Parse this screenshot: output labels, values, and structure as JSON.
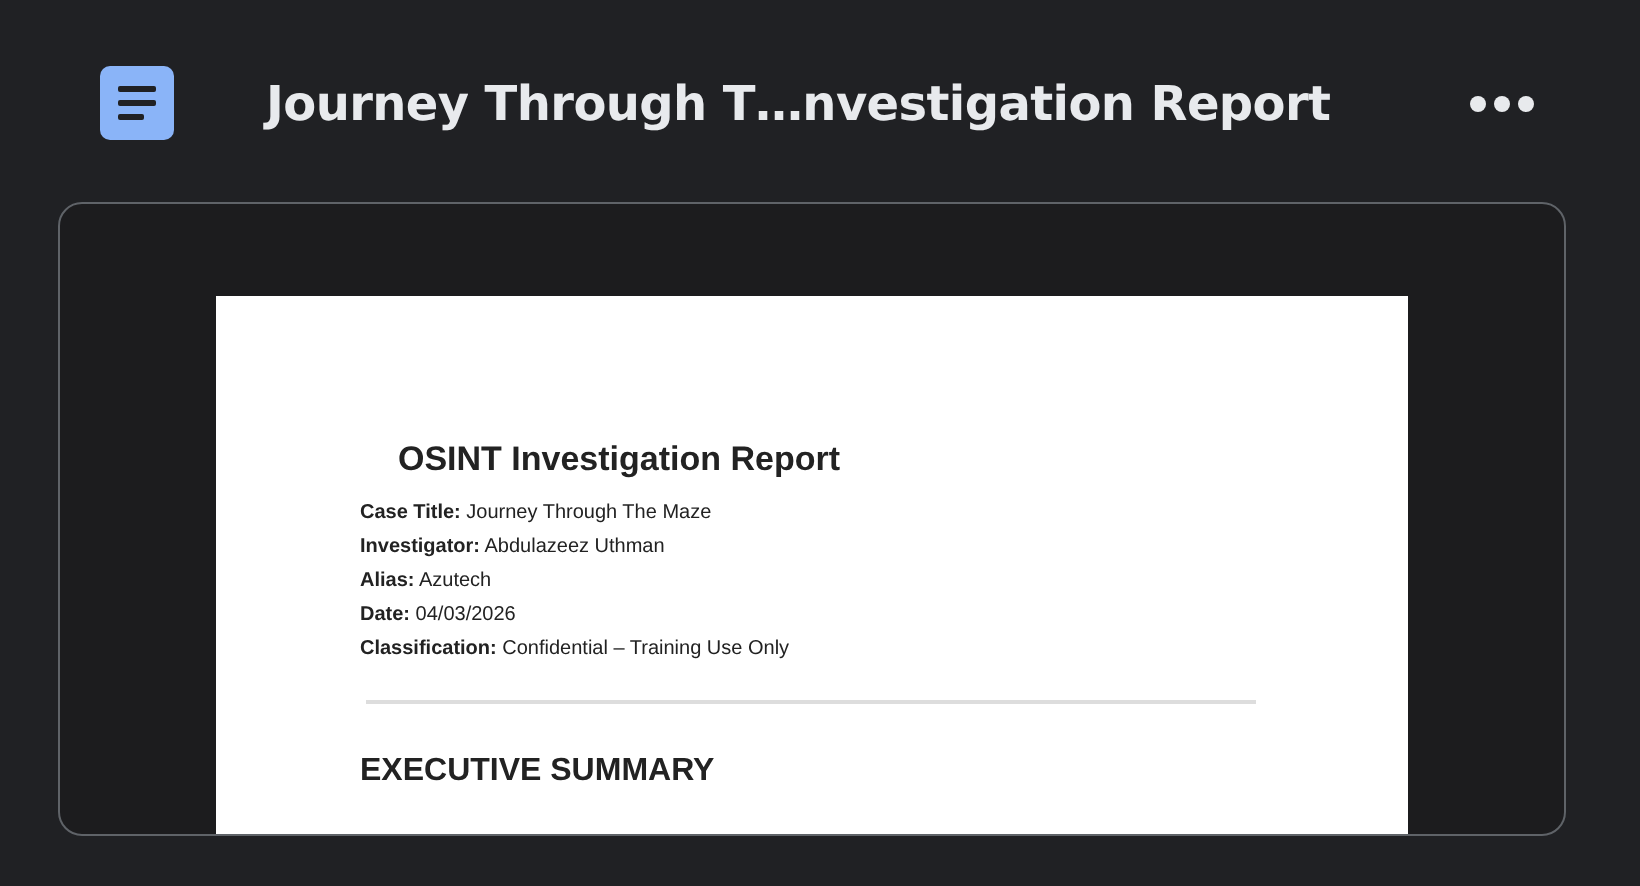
{
  "header": {
    "title": "Journey Through T…nvestigation Report"
  },
  "preview": {
    "doc_title": "OSINT Investigation Report",
    "fields": [
      {
        "label": "Case Title:",
        "value": "Journey Through The Maze"
      },
      {
        "label": "Investigator:",
        "value": "Abdulazeez Uthman"
      },
      {
        "label": "Alias:",
        "value": "Azutech"
      },
      {
        "label": "Date:",
        "value": "04/03/2026"
      },
      {
        "label": "Classification:",
        "value": "Confidential – Training Use Only"
      }
    ],
    "section_heading": "EXECUTIVE SUMMARY"
  }
}
